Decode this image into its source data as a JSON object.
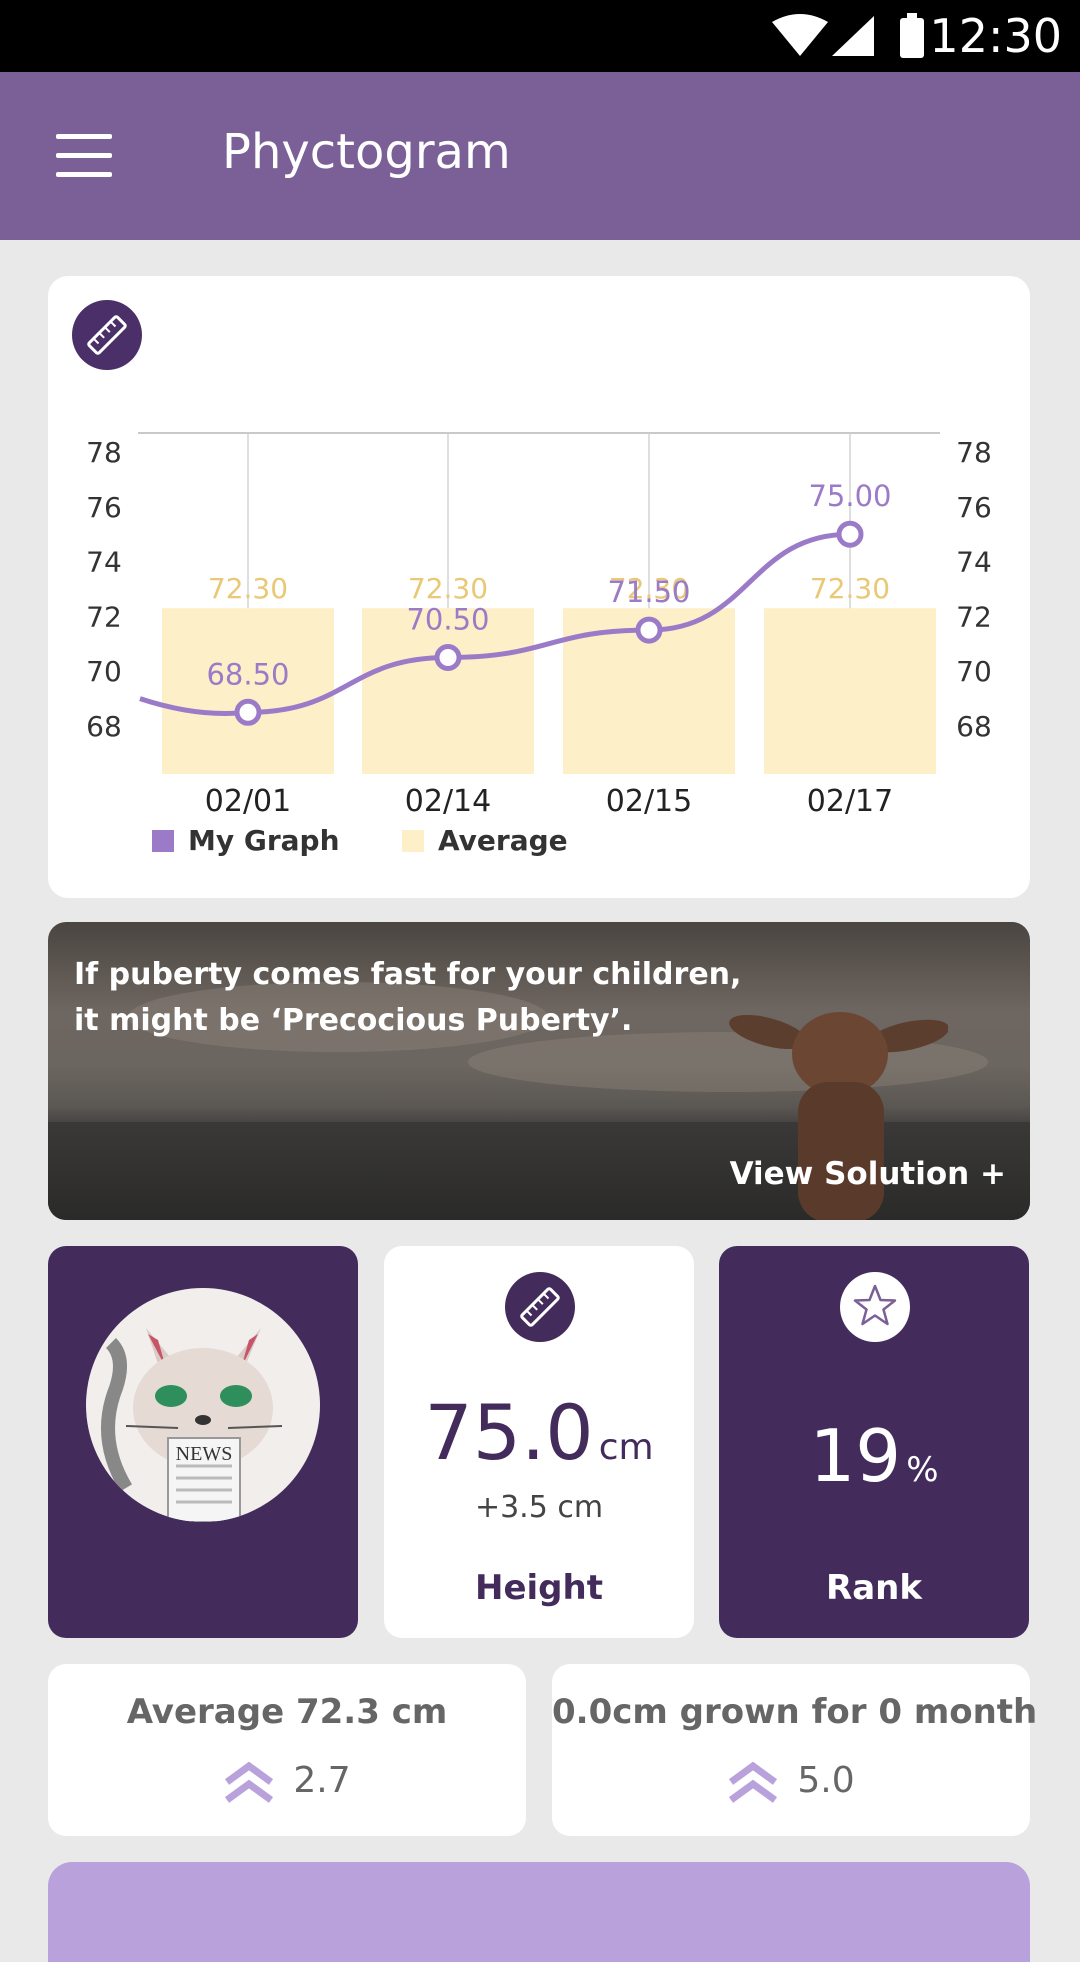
{
  "status_bar": {
    "time": "12:30"
  },
  "app_bar": {
    "title": "Phyctogram"
  },
  "chart_data": {
    "type": "bar",
    "categories": [
      "02/01",
      "02/14",
      "02/15",
      "02/17"
    ],
    "series": [
      {
        "name": "Average",
        "type": "bar",
        "values": [
          72.3,
          72.3,
          72.3,
          72.3
        ],
        "labels": [
          "72.30",
          "72.30",
          "72.30",
          "72.30"
        ],
        "color": "#fdefc8",
        "label_color": "#e9c876"
      },
      {
        "name": "My Graph",
        "type": "line",
        "values": [
          68.5,
          70.5,
          71.5,
          75.0
        ],
        "labels": [
          "68.50",
          "70.50",
          "71.50",
          "75.00"
        ],
        "color": "#9b7bc8"
      }
    ],
    "yticks": [
      "78",
      "76",
      "74",
      "72",
      "70",
      "68"
    ],
    "ylim": [
      68,
      78
    ],
    "legend": [
      {
        "label": "My Graph",
        "color": "#9b7bc8"
      },
      {
        "label": "Average",
        "color": "#fdefc8"
      }
    ],
    "legend_position": "bottom-left"
  },
  "banner": {
    "line1": "If puberty comes fast for your children,",
    "line2": "it might be ‘Precocious Puberty’.",
    "link_label": "View Solution  +"
  },
  "tiles": {
    "avatar": {
      "badge_text": "NEWS"
    },
    "height": {
      "value": "75.0",
      "unit": "cm",
      "delta": "+3.5 cm",
      "label": "Height"
    },
    "rank": {
      "value": "19",
      "unit": "%",
      "label": "Rank"
    }
  },
  "info": {
    "average": {
      "text": "Average 72.3 cm",
      "value": "2.7"
    },
    "grown": {
      "text": "0.0cm grown for 0 month",
      "value": "5.0"
    }
  },
  "colors": {
    "accent": "#7a6096",
    "dark_purple": "#432c5c",
    "light_purple": "#b9a2dc",
    "average_bar": "#fdefc8"
  }
}
